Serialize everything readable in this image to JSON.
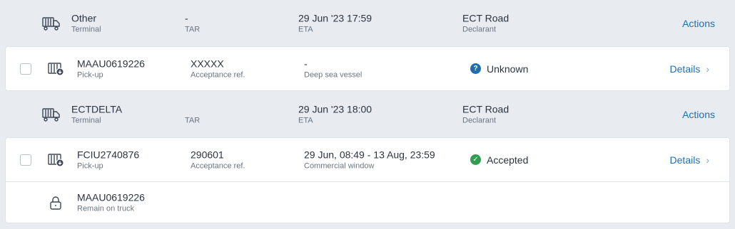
{
  "colors": {
    "accent": "#1f6fb0",
    "unknown_status": "#1f6fb0",
    "accepted_status": "#2e9e4f",
    "group_bg": "#e8ebef",
    "card_bg": "#ffffff"
  },
  "rows": [
    {
      "kind": "group",
      "icon": "truck-icon",
      "c1_main": "Other",
      "c1_sub": "Terminal",
      "c2_main": "-",
      "c2_sub": "TAR",
      "c3_main": "29 Jun '23 17:59",
      "c3_sub": "ETA",
      "c4_main": "ECT Road",
      "c4_sub": "Declarant",
      "action": "Actions"
    },
    {
      "kind": "card",
      "icon": "container-pickup-icon",
      "c1_main": "MAAU0619226",
      "c1_sub": "Pick-up",
      "c2_main": "XXXXX",
      "c2_sub": "Acceptance ref.",
      "c3_main": "-",
      "c3_sub": "Deep sea vessel",
      "status": "Unknown",
      "status_icon": "question-icon",
      "action": "Details"
    },
    {
      "kind": "group",
      "icon": "truck-icon",
      "c1_main": "ECTDELTA",
      "c1_sub": "Terminal",
      "c2_main": "",
      "c2_sub": "TAR",
      "c3_main": "29 Jun '23 18:00",
      "c3_sub": "ETA",
      "c4_main": "ECT Road",
      "c4_sub": "Declarant",
      "action": "Actions"
    },
    {
      "kind": "card",
      "icon": "container-pickup-icon",
      "c1_main": "FCIU2740876",
      "c1_sub": "Pick-up",
      "c2_main": "290601",
      "c2_sub": "Acceptance ref.",
      "c3_main": "29 Jun, 08:49 - 13 Aug, 23:59",
      "c3_sub": "Commercial window",
      "status": "Accepted",
      "status_icon": "check-icon",
      "action": "Details"
    },
    {
      "kind": "card",
      "icon": "lock-icon",
      "c1_main": "MAAU0619226",
      "c1_sub": "Remain on truck"
    }
  ]
}
